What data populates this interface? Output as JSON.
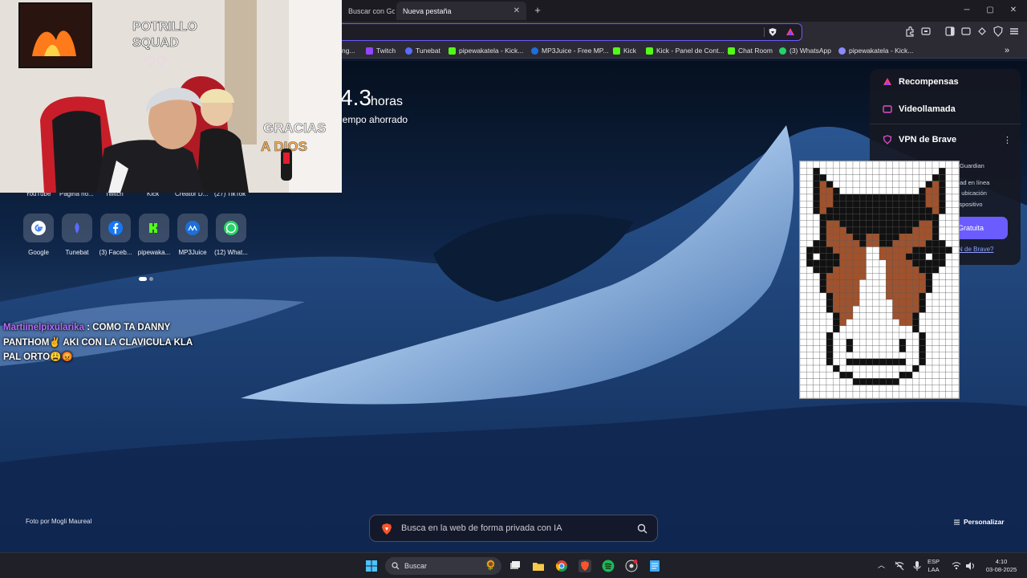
{
  "browser": {
    "tabs": [
      {
        "label": "Buscar con Goog",
        "active": false
      },
      {
        "label": "Nueva pestaña",
        "active": true
      }
    ],
    "new_tab_symbol": "+",
    "window_controls": {
      "minimize": "─",
      "maximize": "▢",
      "close": "✕"
    },
    "bookmarks": [
      {
        "label": "ng...",
        "icon": "generic-icon",
        "color": "#888888"
      },
      {
        "label": "Twitch",
        "icon": "twitch-icon",
        "color": "#9146ff"
      },
      {
        "label": "Tunebat",
        "icon": "tunebat-icon",
        "color": "#5a6cff"
      },
      {
        "label": "pipewakatela - Kick...",
        "icon": "kick-icon",
        "color": "#53fc18"
      },
      {
        "label": "MP3Juice - Free MP...",
        "icon": "mp3juice-icon",
        "color": "#1e6fd9"
      },
      {
        "label": "Kick",
        "icon": "kick-icon",
        "color": "#53fc18"
      },
      {
        "label": "Kick - Panel de Cont...",
        "icon": "kick-icon",
        "color": "#53fc18"
      },
      {
        "label": "Chat Room",
        "icon": "kick-icon",
        "color": "#53fc18"
      },
      {
        "label": "(3) WhatsApp",
        "icon": "whatsapp-icon",
        "color": "#25d366"
      },
      {
        "label": "pipewakatela - Kick...",
        "icon": "link-icon",
        "color": "#8a8aff"
      }
    ],
    "more_bookmarks": "»"
  },
  "stats": {
    "value": "4.3",
    "unit": "horas",
    "label": "iempo ahorrado"
  },
  "top_row_labels": [
    "YouTube",
    "Página no...",
    "Twitch",
    "Kick",
    "Creator D...",
    "(27) TikTok"
  ],
  "top_sites": [
    {
      "label": "Google",
      "icon": "google-icon"
    },
    {
      "label": "Tunebat",
      "icon": "tunebat-icon"
    },
    {
      "label": "(3) Faceb...",
      "icon": "facebook-icon"
    },
    {
      "label": "pipewaka...",
      "icon": "kick-icon"
    },
    {
      "label": "MP3Juice",
      "icon": "mp3juice-icon"
    },
    {
      "label": "(12) What...",
      "icon": "whatsapp-icon"
    }
  ],
  "panel": {
    "rewards": "Recompensas",
    "video_call": "Videollamada",
    "vpn": "VPN de Brave",
    "guardian": "Guardian",
    "lines": [
      "dad en línea",
      "u ubicación",
      "lispositivo"
    ],
    "cta": "Gratuita",
    "cta_link": "N de Brave?"
  },
  "chat": {
    "username": "Martiinelpixularika",
    "message": ": COMO TA DANNY PANTHOM✌️ AKI CON LA CLAVICULA KLA PAL ORTO😩😡"
  },
  "footer": {
    "photo_credit": "Foto por Mogli Maureal",
    "customize": "Personalizar",
    "search_placeholder": "Busca en la web de forma privada con IA"
  },
  "taskbar": {
    "search": "Buscar",
    "lang_top": "ESP",
    "lang_bottom": "LAA",
    "time": "4:10",
    "date": "03-08-2025"
  },
  "colors": {
    "accent": "#6b5cff",
    "tab_bar": "#1c1b22",
    "toolbar": "#2c2b34",
    "chat_user": "#b56cff"
  }
}
